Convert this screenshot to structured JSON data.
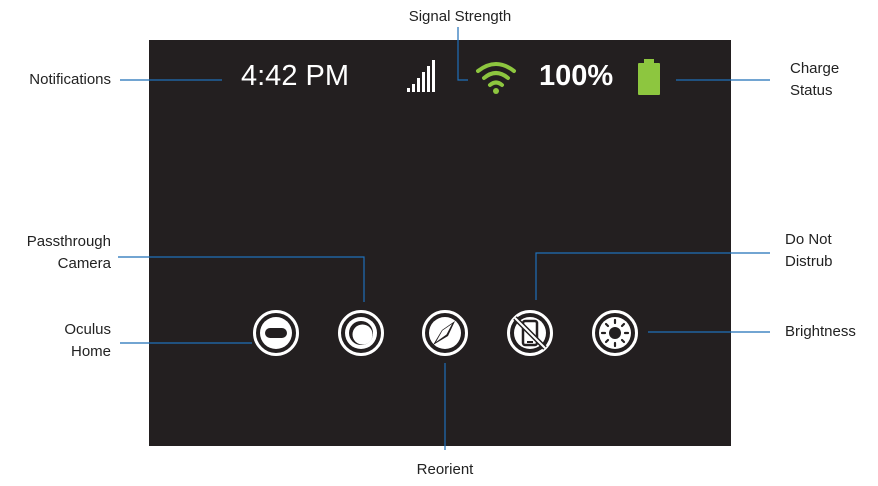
{
  "status_bar": {
    "time": "4:42 PM",
    "battery_percent": "100%"
  },
  "labels": {
    "signal_strength": "Signal Strength",
    "notifications": "Notifications",
    "charge_status_line1": "Charge",
    "charge_status_line2": "Status",
    "passthrough_line1": "Passthrough",
    "passthrough_line2": "Camera",
    "do_not_disturb_line1": "Do Not",
    "do_not_disturb_line2": "Distrub",
    "oculus_home_line1": "Oculus",
    "oculus_home_line2": "Home",
    "brightness": "Brightness",
    "reorient": "Reorient"
  },
  "colors": {
    "screen_bg": "#231f20",
    "accent_green": "#8dc63f",
    "callout_line": "#1f6fb8",
    "icon_white": "#ffffff"
  },
  "icons": [
    "cellular-signal-icon",
    "wifi-icon",
    "battery-icon",
    "oculus-home-icon",
    "passthrough-camera-icon",
    "reorient-compass-icon",
    "do-not-disturb-icon",
    "brightness-icon"
  ]
}
